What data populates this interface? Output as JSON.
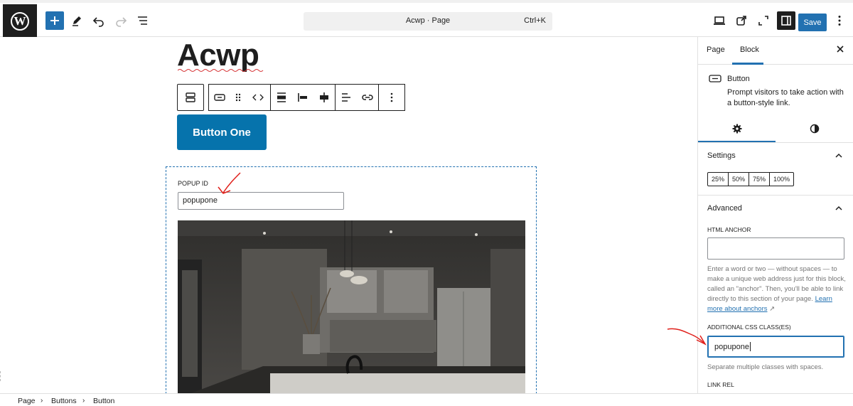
{
  "topbar": {
    "logo_letter": "W",
    "command_title": "Acwp · Page",
    "command_shortcut": "Ctrl+K",
    "save_label": "Save"
  },
  "canvas": {
    "page_title": "Acwp",
    "button_label": "Button One",
    "popup": {
      "label": "POPUP ID",
      "value": "popupone"
    }
  },
  "sidebar": {
    "tabs": [
      "Page",
      "Block"
    ],
    "active_tab": "Block",
    "close_icon": "close-icon",
    "block": {
      "name": "Button",
      "description": "Prompt visitors to take action with a button-style link."
    },
    "settings": {
      "heading": "Settings",
      "widths": [
        "25%",
        "50%",
        "75%",
        "100%"
      ]
    },
    "advanced": {
      "heading": "Advanced",
      "anchor_label": "HTML ANCHOR",
      "anchor_value": "",
      "anchor_help": "Enter a word or two — without spaces — to make a unique web address just for this block, called an \"anchor\". Then, you'll be able to link directly to this section of your page.",
      "anchor_help_link": "Learn more about anchors",
      "css_label": "ADDITIONAL CSS CLASS(ES)",
      "css_value": "popupone",
      "css_help": "Separate multiple classes with spaces.",
      "link_rel_label": "LINK REL"
    }
  },
  "breadcrumb": [
    "Page",
    "Buttons",
    "Button"
  ],
  "colors": {
    "accent": "#2271b1",
    "button_bg": "#0673ac",
    "annotation": "#e0201b"
  }
}
